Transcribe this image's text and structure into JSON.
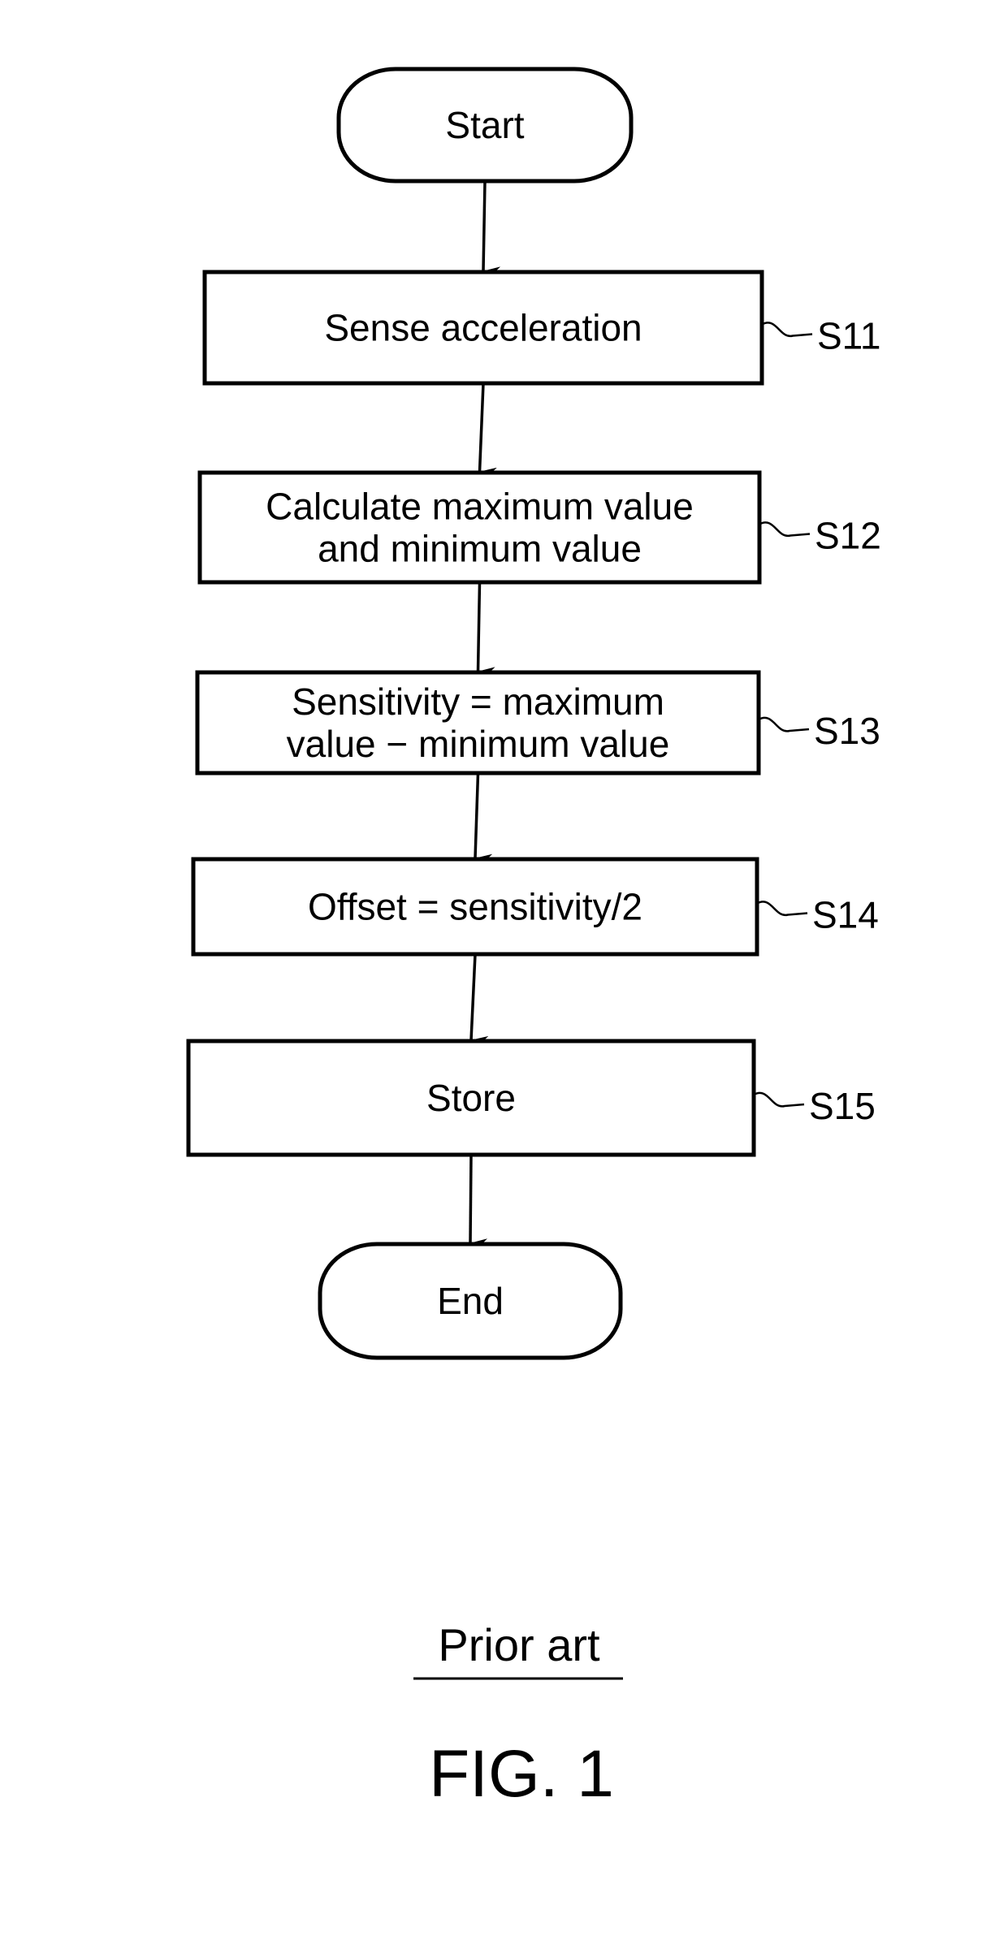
{
  "diagram": {
    "type": "flowchart",
    "nodes": [
      {
        "id": "start",
        "shape": "terminator",
        "label": [
          "Start"
        ],
        "ref": ""
      },
      {
        "id": "s11",
        "shape": "process",
        "label": [
          "Sense acceleration"
        ],
        "ref": "S11"
      },
      {
        "id": "s12",
        "shape": "process",
        "label": [
          "Calculate maximum value",
          "and minimum value"
        ],
        "ref": "S12"
      },
      {
        "id": "s13",
        "shape": "process",
        "label": [
          "Sensitivity = maximum",
          "value − minimum value"
        ],
        "ref": "S13"
      },
      {
        "id": "s14",
        "shape": "process",
        "label": [
          "Offset = sensitivity/2"
        ],
        "ref": "S14"
      },
      {
        "id": "s15",
        "shape": "process",
        "label": [
          "Store"
        ],
        "ref": "S15"
      },
      {
        "id": "end",
        "shape": "terminator",
        "label": [
          "End"
        ],
        "ref": ""
      }
    ],
    "edges": [
      {
        "from": "start",
        "to": "s11"
      },
      {
        "from": "s11",
        "to": "s12"
      },
      {
        "from": "s12",
        "to": "s13"
      },
      {
        "from": "s13",
        "to": "s14"
      },
      {
        "from": "s14",
        "to": "s15"
      },
      {
        "from": "s15",
        "to": "end"
      }
    ]
  },
  "caption": {
    "subtitle": "Prior art",
    "figure_label": "FIG. 1"
  }
}
